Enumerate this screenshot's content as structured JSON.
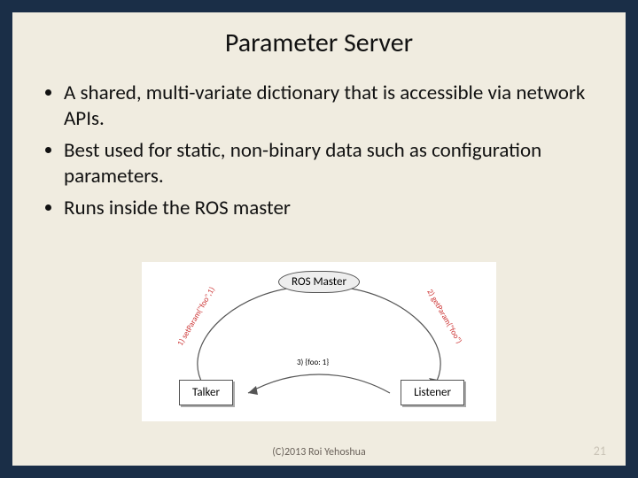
{
  "title": "Parameter Server",
  "bullets": [
    "A shared, multi-variate dictionary that is accessible via network APIs.",
    "Best used for static, non-binary data such as configuration parameters.",
    "Runs inside the ROS master"
  ],
  "diagram": {
    "master": "ROS Master",
    "talker": "Talker",
    "listener": "Listener",
    "label1": "1) setParam(\"foo\",1)",
    "label2": "2) getParam(\"foo\")",
    "label3": "3) {foo: 1}"
  },
  "footer": "(C)2013 Roi Yehoshua",
  "page": "21"
}
